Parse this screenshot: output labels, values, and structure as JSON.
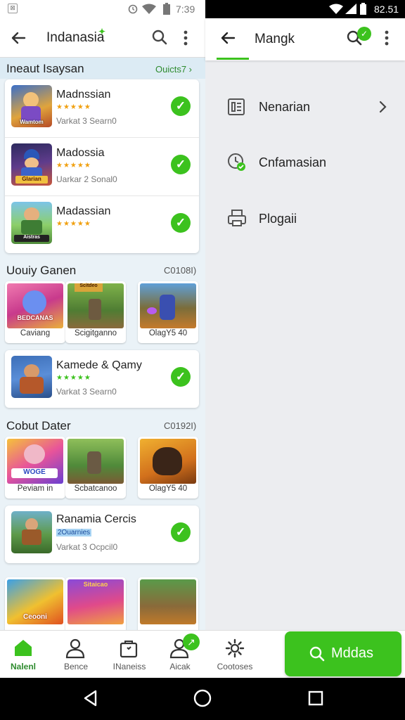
{
  "status_left": {
    "time": "7:39"
  },
  "status_right": {
    "time": "82.51"
  },
  "left_header": {
    "title": "Indanasia"
  },
  "sections": [
    {
      "title": "Ineaut Isaysan",
      "link": "Ouicts7 ›"
    },
    {
      "title": "Uouiy Ganen",
      "count": "C0108I)"
    },
    {
      "title": "Cobut Dater",
      "count": "C0192I)"
    }
  ],
  "apps": [
    {
      "name": "Madnssian",
      "stars": "★★★★★",
      "sub": "Varkat 3 Searn0"
    },
    {
      "name": "Madossia",
      "stars": "★★★★★",
      "sub": "Uarkar 2 Sonal0"
    },
    {
      "name": "Madassian",
      "stars": "★★★★★",
      "sub": ""
    },
    {
      "name": "Kamede & Qamy",
      "stars": "★★★★★",
      "sub": "Varkat 3 Searn0"
    },
    {
      "name": "Ranamia Cercis",
      "tag": "2Ouarnies",
      "sub": "Varkat 3 Ocpcil0"
    }
  ],
  "thumb_text": [
    "Wamtom",
    "Glarian",
    "Aistras"
  ],
  "row1": [
    {
      "caption": "Caviang",
      "art": "BEDCANAS"
    },
    {
      "caption": "Scigitganno",
      "art": "Scitdeo"
    },
    {
      "caption": "OlagY5 40",
      "art": ""
    }
  ],
  "row2": [
    {
      "caption": "Peviam in",
      "art": "WOGE"
    },
    {
      "caption": "Scbatcanoo",
      "art": ""
    },
    {
      "caption": "OlagY5 40",
      "art": ""
    }
  ],
  "row3": [
    {
      "art": "Ceooni"
    },
    {
      "art": "Sitaicao"
    },
    {
      "art": ""
    }
  ],
  "right_header": {
    "title": "Mangk"
  },
  "menu": [
    {
      "label": "Nenarian",
      "icon": "newspaper-icon"
    },
    {
      "label": "Cnfamasian",
      "icon": "clock-check-icon"
    },
    {
      "label": "Plogaii",
      "icon": "printer-icon"
    }
  ],
  "bottom_nav": [
    {
      "label": "Nalenl",
      "icon": "home-icon"
    },
    {
      "label": "Bence",
      "icon": "person-icon"
    },
    {
      "label": "INaneiss",
      "icon": "bag-icon"
    },
    {
      "label": "Aicak",
      "icon": "person-badge-icon"
    },
    {
      "label": "Cootoses",
      "icon": "gear-icon"
    }
  ],
  "action_button": {
    "label": "Mddas"
  },
  "colors": {
    "accent": "#3cc21e",
    "link": "#2e8b2e",
    "stars": "#f0a010"
  }
}
